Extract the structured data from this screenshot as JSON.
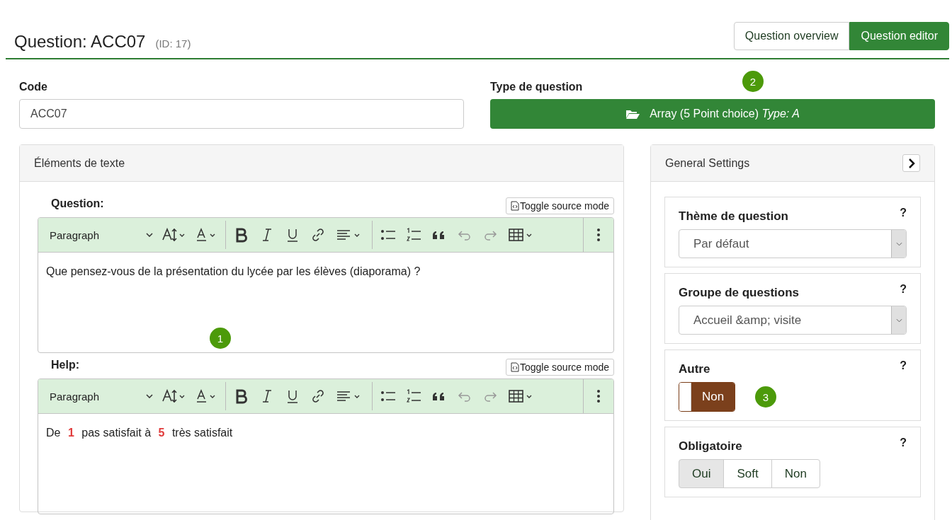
{
  "header": {
    "title": "Question: ACC07",
    "id": "(ID: 17)"
  },
  "tabs": [
    {
      "label": "Question overview",
      "selected": false
    },
    {
      "label": "Question editor",
      "selected": true
    }
  ],
  "code": {
    "label": "Code",
    "value": "ACC07"
  },
  "question_type": {
    "label": "Type de question",
    "value": "Array (5 Point choice) *Type: A*"
  },
  "markers": [
    "1",
    "2",
    "3"
  ],
  "text_panel": {
    "title": "Éléments de texte",
    "editors": [
      {
        "label": "Question:",
        "toggle": "Toggle source mode",
        "format": "Paragraph",
        "content": "Que pensez-vous de la présentation du lycée par les élèves (diaporama) ?",
        "toolbar": [
          {
            "kind": "size",
            "disabled": false
          },
          {
            "kind": "color",
            "disabled": false
          },
          {
            "kind": "bold",
            "disabled": false
          },
          {
            "kind": "italic",
            "disabled": false
          },
          {
            "kind": "underline",
            "disabled": false
          },
          {
            "kind": "link",
            "disabled": false
          },
          {
            "kind": "align",
            "disabled": false
          },
          {
            "kind": "bullets",
            "disabled": false
          },
          {
            "kind": "numbers",
            "disabled": false
          },
          {
            "kind": "quote",
            "disabled": false
          },
          {
            "kind": "undo",
            "disabled": true
          },
          {
            "kind": "redo",
            "disabled": true
          },
          {
            "kind": "table",
            "disabled": false
          }
        ]
      },
      {
        "label": "Help:",
        "toggle": "Toggle source mode",
        "format": "Paragraph",
        "content": "De **1** pas satisfait à **5** très satisfait",
        "toolbar": [
          {
            "kind": "size",
            "disabled": false
          },
          {
            "kind": "color",
            "disabled": false
          },
          {
            "kind": "bold",
            "disabled": false
          },
          {
            "kind": "italic",
            "disabled": false
          },
          {
            "kind": "underline",
            "disabled": false
          },
          {
            "kind": "link",
            "disabled": false
          },
          {
            "kind": "align",
            "disabled": false
          },
          {
            "kind": "bullets",
            "disabled": false
          },
          {
            "kind": "numbers",
            "disabled": false
          },
          {
            "kind": "quote",
            "disabled": false
          },
          {
            "kind": "undo",
            "disabled": true
          },
          {
            "kind": "redo",
            "disabled": true
          },
          {
            "kind": "table",
            "disabled": false
          }
        ]
      }
    ]
  },
  "settings_panel": {
    "title": "General Settings",
    "cards": [
      {
        "kind": "select",
        "label": "Thème de question",
        "help": "?",
        "value": "Par défaut"
      },
      {
        "kind": "select",
        "label": "Groupe de questions",
        "help": "?",
        "value": "Accueil &amp; visite"
      },
      {
        "kind": "toggle",
        "label": "Autre",
        "help": "?",
        "value": "Non",
        "on": false
      },
      {
        "kind": "choice",
        "label": "Obligatoire",
        "help": "?",
        "options": [
          {
            "label": "Oui",
            "selected": true
          },
          {
            "label": "Soft",
            "selected": false
          },
          {
            "label": "Non",
            "selected": false
          }
        ]
      }
    ]
  }
}
